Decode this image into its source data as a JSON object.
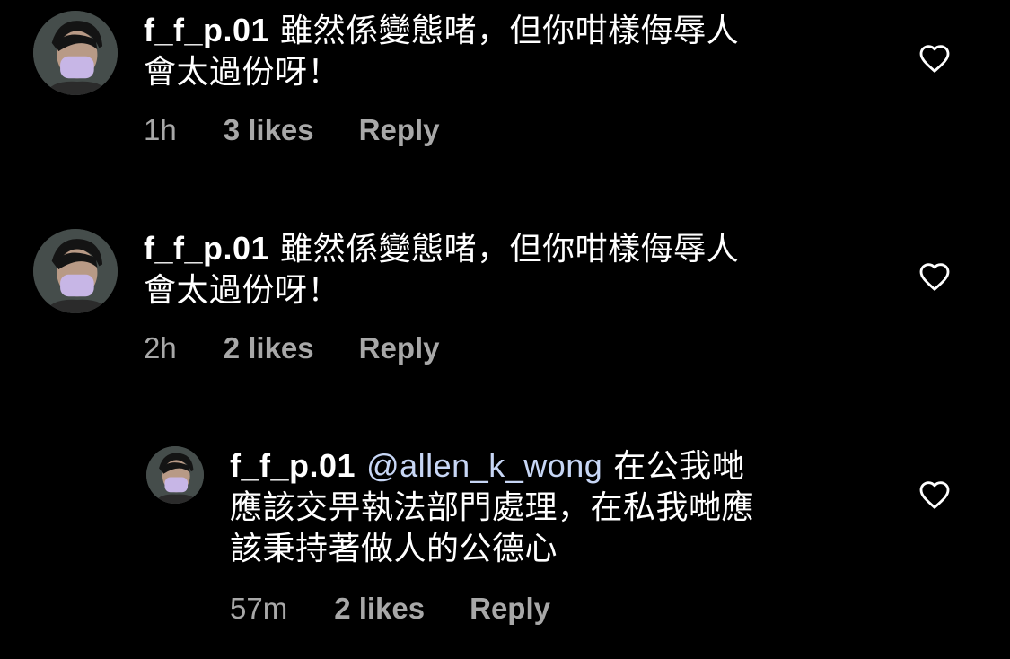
{
  "comments": [
    {
      "username": "f_f_p.01",
      "mention": "",
      "text": "雖然係變態啫，但你咁樣侮辱人會太過份呀！",
      "lines": [
        "雖然係變態啫，但你咁樣侮辱人",
        "會太過份呀！"
      ],
      "time": "1h",
      "likes": "3 likes",
      "reply": "Reply"
    },
    {
      "username": "f_f_p.01",
      "mention": "",
      "text": "雖然係變態啫，但你咁樣侮辱人會太過份呀！",
      "lines": [
        "雖然係變態啫，但你咁樣侮辱人",
        "會太過份呀！"
      ],
      "time": "2h",
      "likes": "2 likes",
      "reply": "Reply"
    },
    {
      "username": "f_f_p.01",
      "mention": "@allen_k_wong",
      "text": "在公我哋應該交畀執法部門處理，在私我哋應該秉持著做人的公德心",
      "lines": [
        "在公我哋",
        "應該交畀執法部門處理，在私我哋應",
        "該秉持著做人的公德心"
      ],
      "time": "57m",
      "likes": "2 likes",
      "reply": "Reply"
    }
  ],
  "icons": {
    "like": "heart-outline-icon",
    "avatar": "profile-photo-masked-person"
  },
  "colors": {
    "background": "#000000",
    "text": "#ffffff",
    "meta": "#a8a8a8",
    "mention": "#c7d6f5"
  }
}
